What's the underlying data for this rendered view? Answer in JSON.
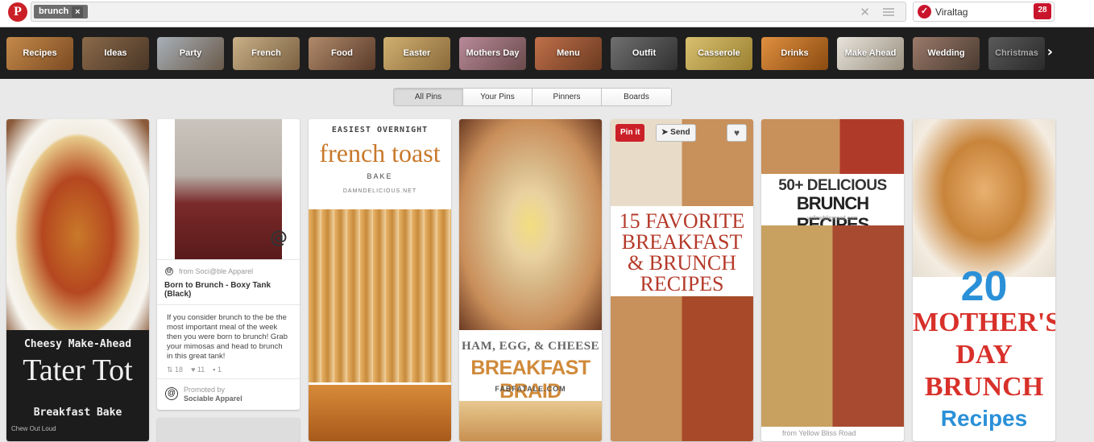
{
  "topbar": {
    "search_token": "brunch",
    "viraltag_label": "Viraltag",
    "viraltag_count": "28"
  },
  "categories": [
    "Recipes",
    "Ideas",
    "Party",
    "French",
    "Food",
    "Easter",
    "Mothers Day",
    "Menu",
    "Outfit",
    "Casserole",
    "Drinks",
    "Make Ahead",
    "Wedding",
    "Christmas"
  ],
  "tabs": [
    "All Pins",
    "Your Pins",
    "Pinners",
    "Boards"
  ],
  "pins": {
    "tatertot": {
      "line1": "Cheesy Make-Ahead",
      "line2": "Tater Tot",
      "line3": "Breakfast Bake",
      "watermark": "Chew Out Loud"
    },
    "shirt": {
      "source": "from Soci@ble Apparel",
      "title": "Born to Brunch - Boxy Tank (Black)",
      "description": "If you consider brunch to the be the most important meal of the week then you were born to brunch! Grab your mimosas and head to brunch in this great tank!",
      "repins": "18",
      "likes": "11",
      "comments": "1",
      "promoted_label": "Promoted by",
      "promoter": "Sociable Apparel"
    },
    "frenchtoast": {
      "line1": "EASIEST OVERNIGHT",
      "line2": "french toast",
      "line3": "BAKE",
      "site": "DAMNDELICIOUS.NET"
    },
    "braid": {
      "line1": "HAM, EGG, & CHEESE",
      "line2": "BREAKFAST BRAID",
      "site": "FABFATALE.COM"
    },
    "favorite": {
      "pinit": "Pin it",
      "send": "Send",
      "line1": "15 FAVORITE",
      "line2": "BREAKFAST",
      "line3": "& BRUNCH",
      "line4": "RECIPES"
    },
    "fifty": {
      "line1": "50+ DELICIOUS",
      "line2": "BRUNCH RECIPES",
      "site": "yellowblissroad.com",
      "source": "from Yellow Bliss Road"
    },
    "mothers": {
      "line1": "20",
      "line2": "MOTHER'S",
      "line3": "DAY",
      "line4": "BRUNCH",
      "line5": "Recipes"
    }
  },
  "colors": {
    "brand": "#cb2027",
    "viraltag": "#c9152c"
  }
}
